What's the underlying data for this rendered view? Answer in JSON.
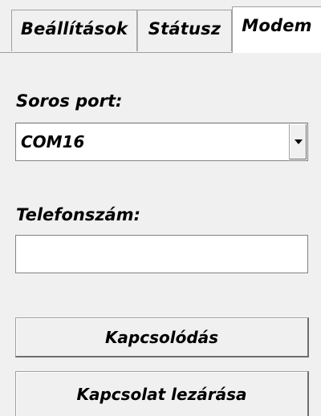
{
  "tabs": [
    {
      "label": "Beállítások",
      "selected": false
    },
    {
      "label": "Státusz",
      "selected": false
    },
    {
      "label": "Modem",
      "selected": true
    }
  ],
  "modem": {
    "serial_port_label": "Soros port:",
    "serial_port_value": "COM16",
    "phone_label": "Telefonszám:",
    "phone_value": "",
    "connect_button": "Kapcsolódás",
    "disconnect_button": "Kapcsolat lezárása"
  }
}
